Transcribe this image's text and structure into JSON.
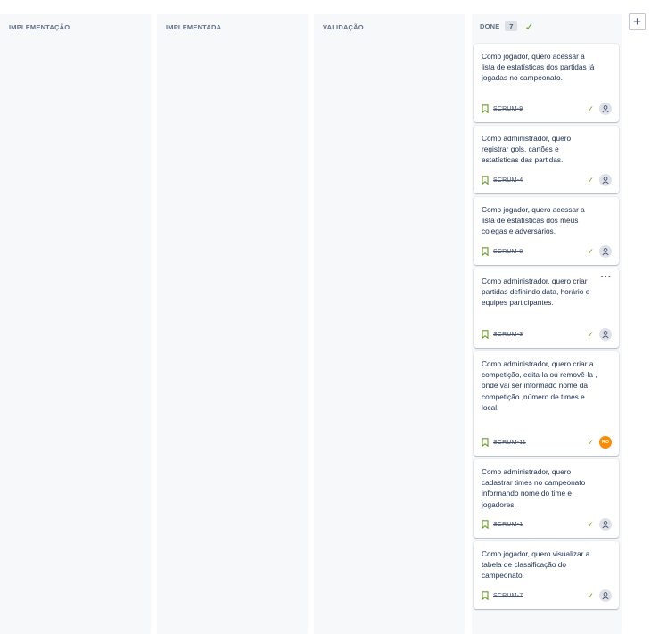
{
  "columns": [
    {
      "title": "IMPLEMENTAÇÃO"
    },
    {
      "title": "IMPLEMENTADA"
    },
    {
      "title": "VALIDAÇÃO"
    },
    {
      "title": "DONE",
      "count": "7"
    }
  ],
  "add_column_label": "+",
  "more_actions_label": "···",
  "cards": [
    {
      "summary": "Como jogador, quero acessar a lista de estatísticas dos partidas já jogadas no campeonato.",
      "key": "SCRUM-9",
      "assignee": ""
    },
    {
      "summary": "Como administrador, quero registrar gols, cartões e estatísticas das partidas.",
      "key": "SCRUM-4",
      "assignee": ""
    },
    {
      "summary": "Como jogador, quero acessar a lista de estatísticas dos meus colegas e adversários.",
      "key": "SCRUM-8",
      "assignee": ""
    },
    {
      "summary": "Como administrador, quero criar partidas definindo data, horário e equipes participantes.",
      "key": "SCRUM-3",
      "assignee": ""
    },
    {
      "summary": "Como administrador, quero criar a competição, edita-la ou removê-la , onde vai ser informado nome da competição ,número de times e local.",
      "key": "SCRUM-11",
      "assignee": "RO"
    },
    {
      "summary": "Como administrador, quero cadastrar times no campeonato informando nome do time e jogadores.",
      "key": "SCRUM-1",
      "assignee": ""
    },
    {
      "summary": "Como jogador, quero visualizar a tabela de classificação do campeonato.",
      "key": "SCRUM-7",
      "assignee": ""
    }
  ],
  "colors": {
    "column_bg": "#f7f8f9",
    "done_green": "#6a9a23",
    "avatar_orange": "#ff8b00"
  },
  "icons": {
    "done": "check-icon",
    "issue_type": "bookmark-icon",
    "assignee": "user-icon",
    "more": "ellipsis-icon",
    "add": "plus-icon"
  }
}
